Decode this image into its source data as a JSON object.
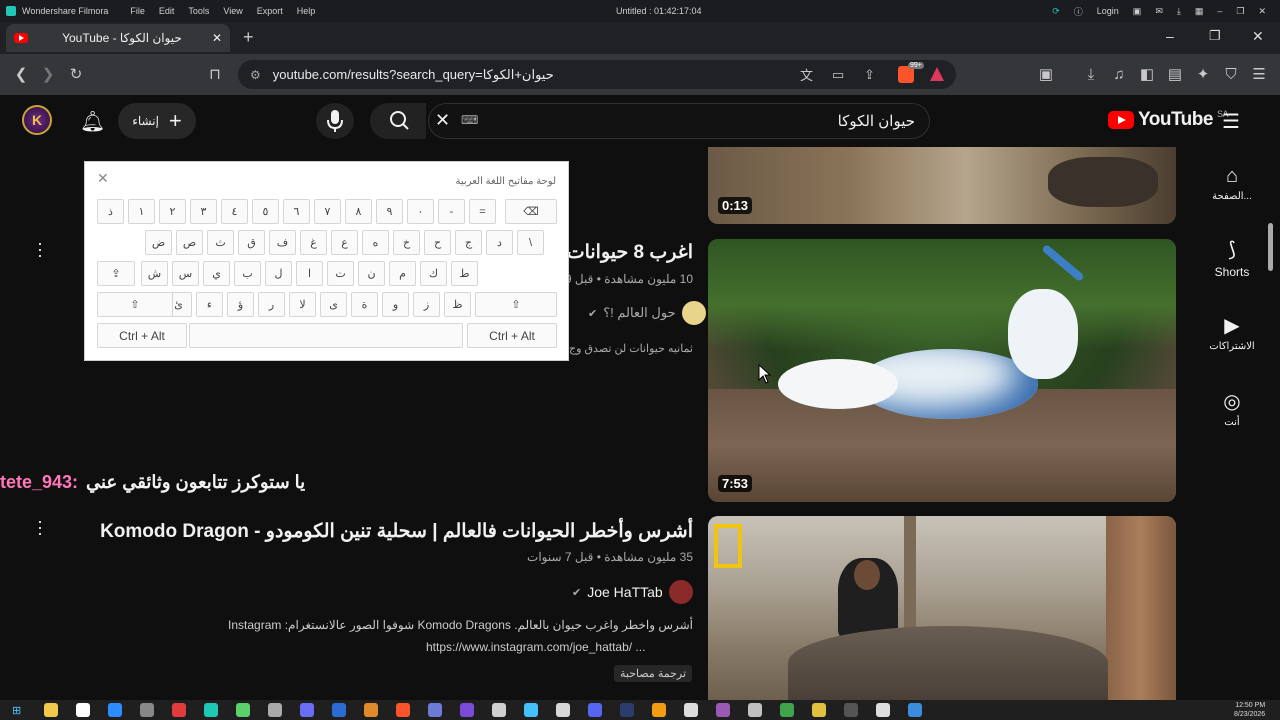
{
  "filmora": {
    "app_name": "Wondershare Filmora",
    "menu": [
      "File",
      "Edit",
      "Tools",
      "View",
      "Export",
      "Help"
    ],
    "project_title": "Untitled : 01:42:17:04",
    "login_label": "Login"
  },
  "browser": {
    "tab_title": "YouTube - حيوان الكوكا",
    "new_tab_symbol": "+",
    "url": "youtube.com/results?search_query=حيوان+الكوكا",
    "brave_badge": "99+"
  },
  "yt": {
    "logo_text": "YouTube",
    "region": "SA",
    "search_query": "حيوان الكوكا",
    "create_label": "إنشاء",
    "avatar_letter": "K"
  },
  "sidebar": {
    "items": [
      {
        "label": "الصفحة...",
        "icon": "home-icon"
      },
      {
        "label": "Shorts",
        "icon": "shorts-icon"
      },
      {
        "label": "الاشتراكات",
        "icon": "subscriptions-icon"
      },
      {
        "label": "أنت",
        "icon": "you-icon"
      }
    ]
  },
  "videos": [
    {
      "duration": "0:13"
    },
    {
      "duration": "7:53",
      "title": "اغرب 8 حيوانات",
      "meta": "10 مليون مشاهدة • قبل 9 س",
      "channel": "حول العالم !؟",
      "desc": "ثمانيه حيوانات لن تصدق وج"
    },
    {
      "title": "أشرس وأخطر الحيوانات فالعالم | سحلية تنين الكومودو - Komodo Dragon",
      "meta": "35 مليون مشاهدة • قبل 7 سنوات",
      "channel": "Joe HaTTab",
      "desc_line1": "أشرس واخطر واغرب حيوان بالعالم. Komodo Dragons شوفوا الصور عالانستغرام: Instagram",
      "desc_line2": "https://www.instagram.com/joe_hattab/ ...",
      "auto_translate": "ترجمة مصاحبة"
    }
  ],
  "keyboard": {
    "title": "لوحة مفاتيح اللغة العربية",
    "row1": [
      "ذ",
      "١",
      "٢",
      "٣",
      "٤",
      "٥",
      "٦",
      "٧",
      "٨",
      "٩",
      "٠",
      "-",
      "="
    ],
    "row2": [
      "ض",
      "ص",
      "ث",
      "ق",
      "ف",
      "غ",
      "ع",
      "ه",
      "خ",
      "ح",
      "ج",
      "د",
      "\\"
    ],
    "row3": [
      "ش",
      "س",
      "ي",
      "ب",
      "ل",
      "ا",
      "ت",
      "ن",
      "م",
      "ك",
      "ط"
    ],
    "row4": [
      "ئ",
      "ء",
      "ؤ",
      "ر",
      "لا",
      "ى",
      "ة",
      "و",
      "ز",
      "ظ"
    ],
    "ctrl_alt": "Ctrl + Alt"
  },
  "chat": {
    "user": "tete_943:",
    "message": "يا ستوكرز تتابعون وثائقي عني"
  },
  "taskbar": {
    "time": "12:50 PM",
    "date": "8/23/2026"
  }
}
